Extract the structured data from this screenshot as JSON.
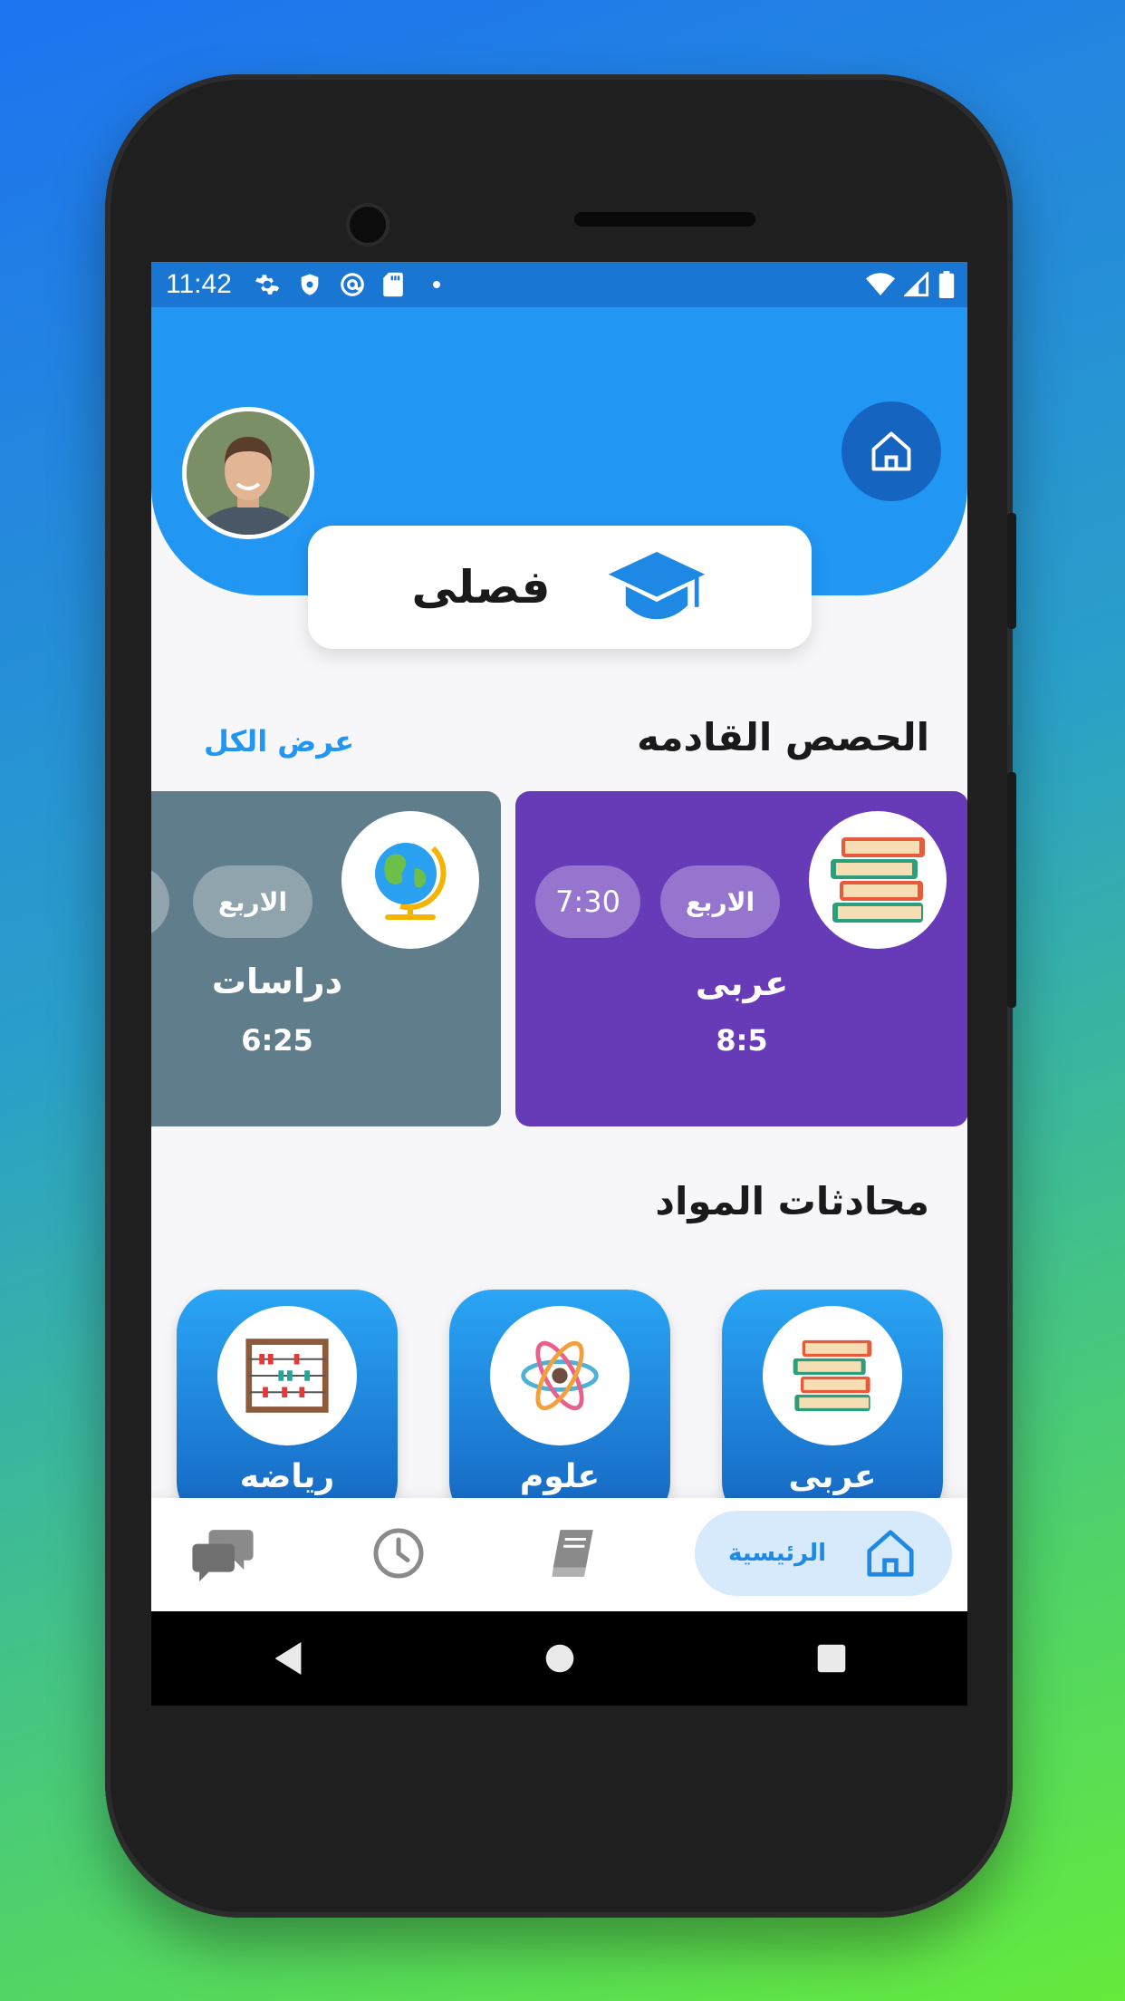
{
  "status_bar": {
    "time": "11:42"
  },
  "header": {
    "page_title": "فصلى"
  },
  "upcoming": {
    "title": "الحصص القادمه",
    "see_all": "عرض الكل",
    "cards": [
      {
        "subject": "عربى",
        "day": "الاربع",
        "start": "7:30",
        "time": "8:5",
        "color": "#673ab7"
      },
      {
        "subject": "دراسات",
        "day": "الاربع",
        "time": "6:25",
        "color": "#607d8b"
      }
    ]
  },
  "subject_chats": {
    "title": "محادثات المواد",
    "items": [
      {
        "label": "عربى",
        "icon": "books-icon"
      },
      {
        "label": "علوم",
        "icon": "atom-icon"
      },
      {
        "label": "رياضه",
        "icon": "abacus-icon"
      }
    ]
  },
  "bottom_nav": {
    "home_label": "الرئيسية"
  },
  "colors": {
    "primary": "#2196f3",
    "primary_dark": "#1565c0",
    "purple_card": "#673ab7",
    "gray_card": "#607d8b"
  }
}
